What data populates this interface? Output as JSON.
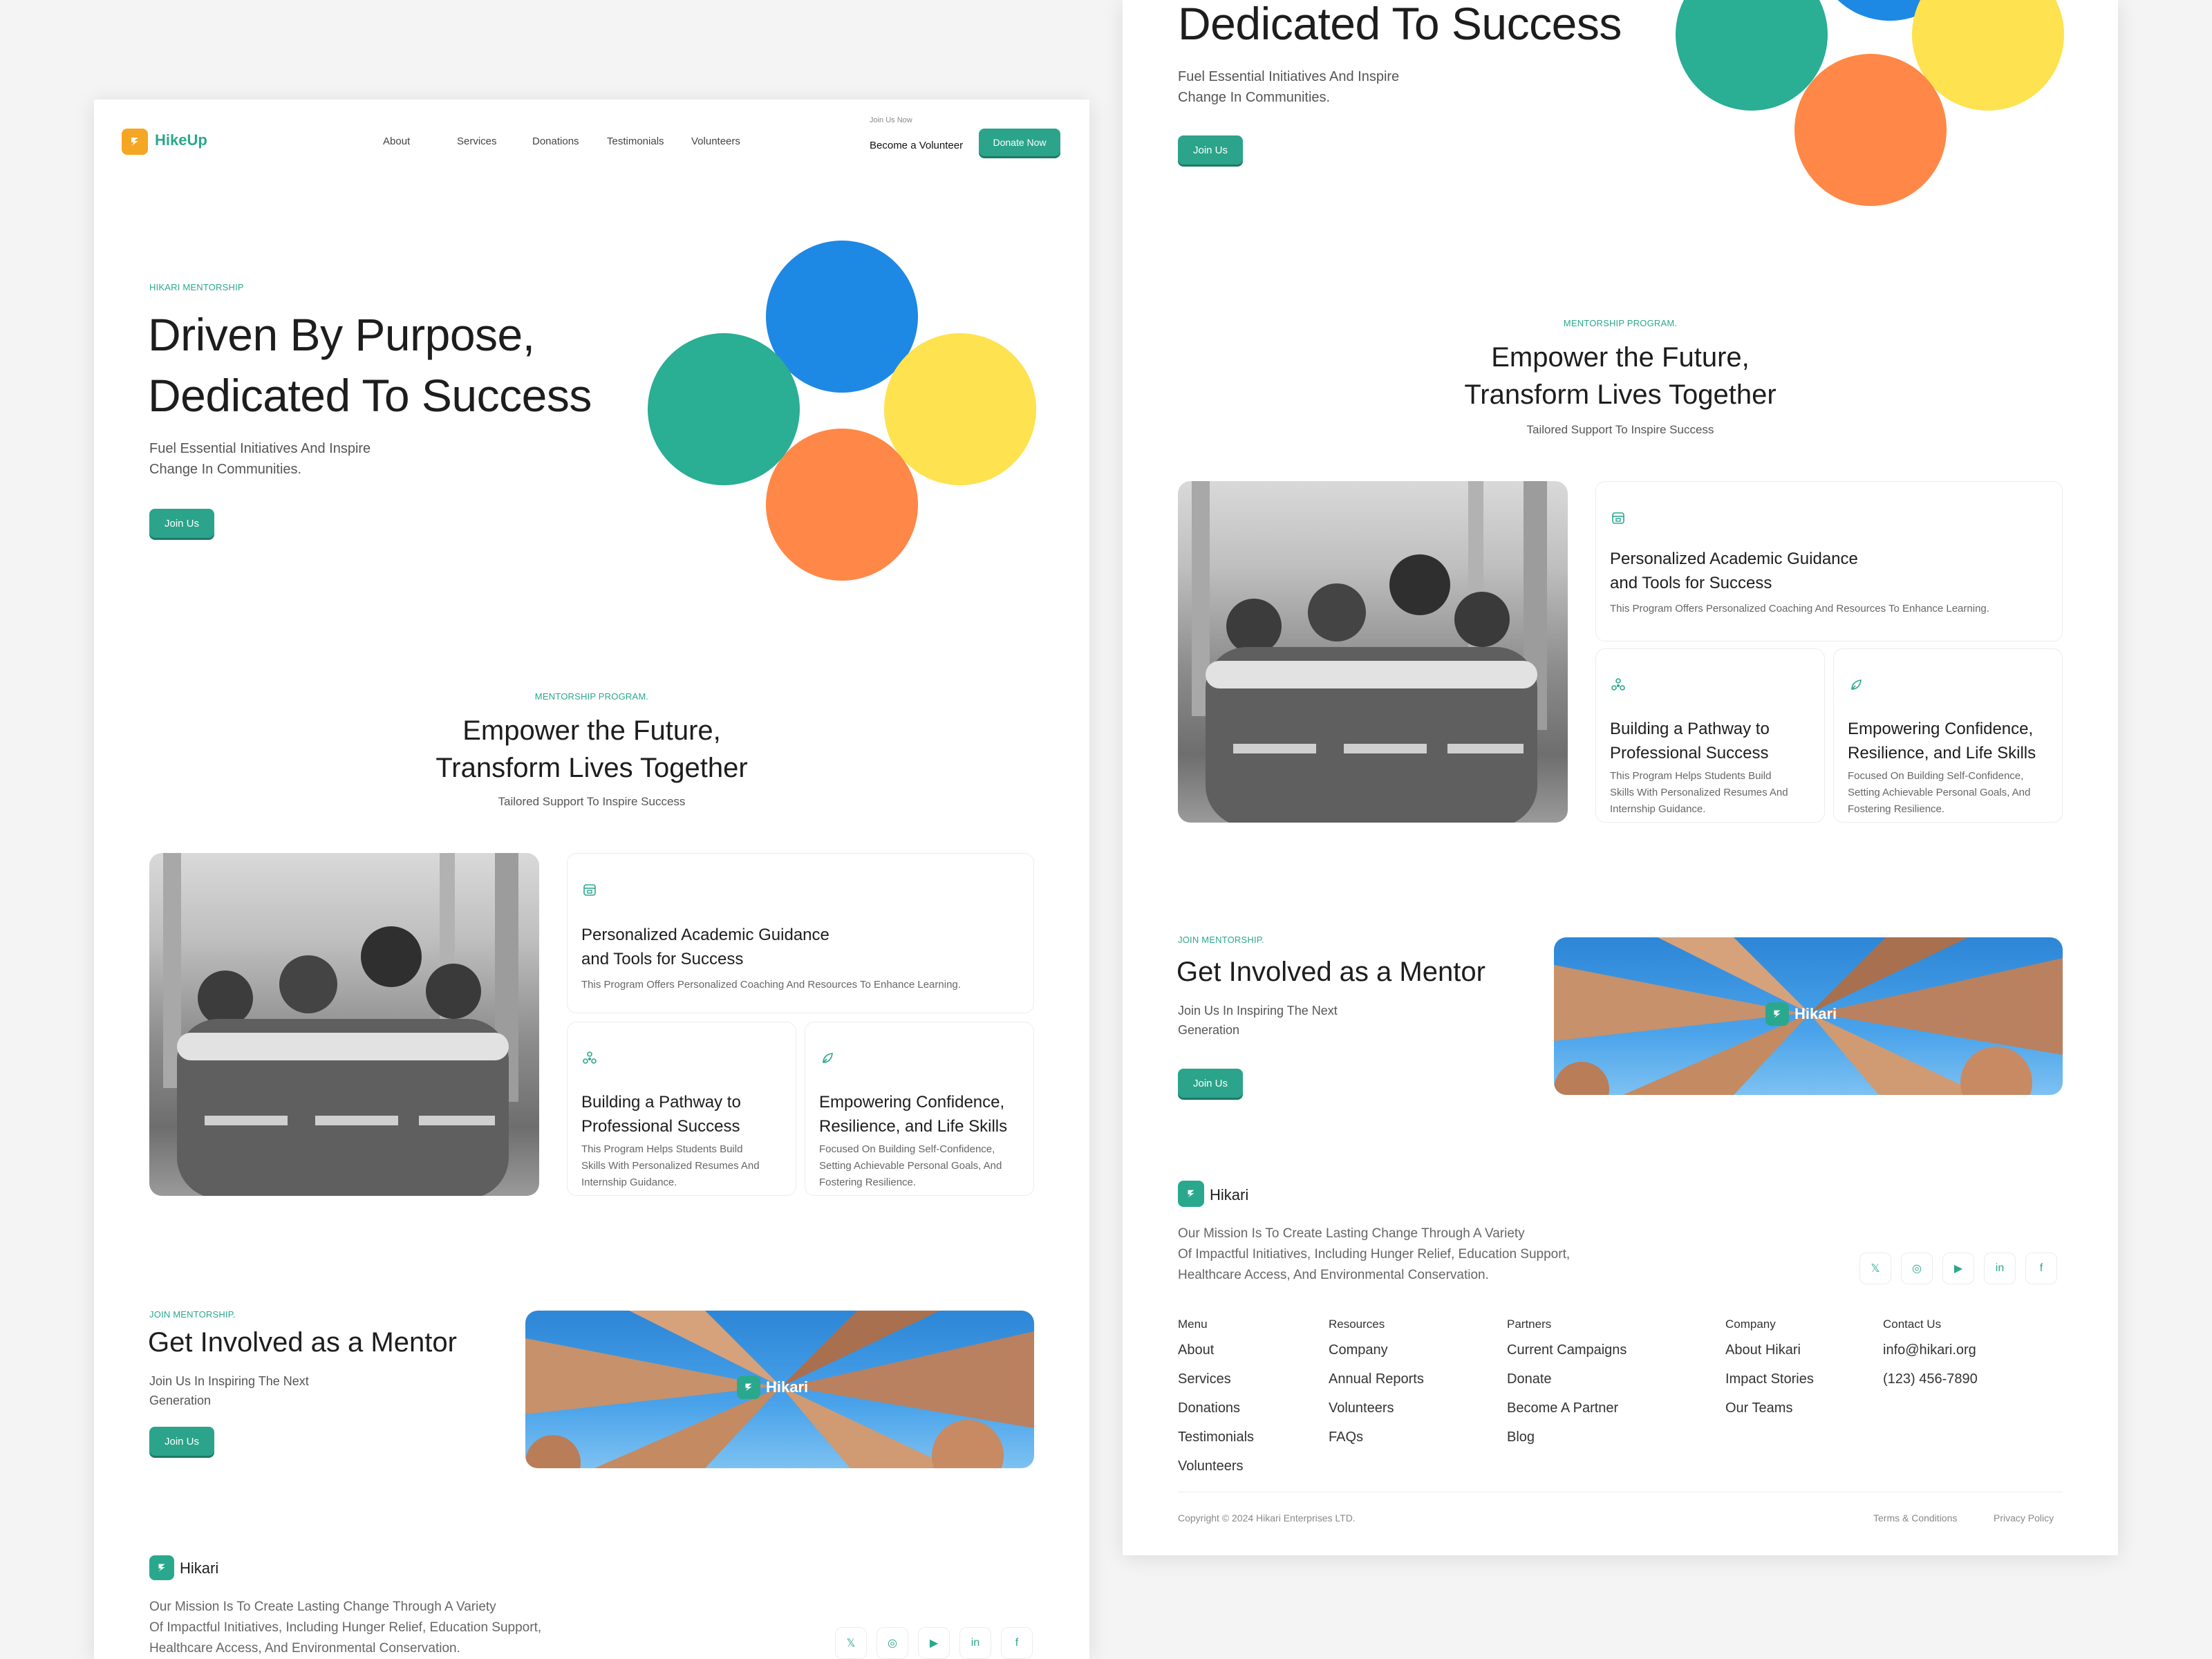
{
  "brand": {
    "name": "HikeUp",
    "footer_name": "Hikari",
    "photo_badge": "Hikari"
  },
  "nav": {
    "items": [
      "About",
      "Services",
      "Donations",
      "Testimonials",
      "Volunteers"
    ],
    "join_small": "Join Us Now",
    "volunteer": "Become a Volunteer",
    "donate": "Donate Now"
  },
  "hero": {
    "eyebrow": "HIKARI MENTORSHIP",
    "title_line1": "Driven By Purpose,",
    "title_line2": "Dedicated To Success",
    "sub_line1": "Fuel Essential Initiatives And Inspire",
    "sub_line2": "Change In Communities.",
    "cta": "Join Us"
  },
  "mentorship": {
    "eyebrow": "MENTORSHIP PROGRAM.",
    "title_line1": "Empower the Future,",
    "title_line2": "Transform Lives Together",
    "sub": "Tailored Support To Inspire Success",
    "features": [
      {
        "title_line1": "Personalized Academic Guidance",
        "title_line2": "and Tools for Success",
        "desc_line1": "This Program Offers Personalized Coaching And Resources To Enhance Learning.",
        "desc_line2": "",
        "desc_line3": ""
      },
      {
        "title_line1": "Building a Pathway to",
        "title_line2": "Professional Success",
        "desc_line1": "This Program Helps Students Build",
        "desc_line2": "Skills With Personalized Resumes And",
        "desc_line3": "Internship Guidance."
      },
      {
        "title_line1": "Empowering Confidence,",
        "title_line2": "Resilience, and Life Skills",
        "desc_line1": "Focused On Building Self-Confidence,",
        "desc_line2": "Setting Achievable Personal Goals, And",
        "desc_line3": "Fostering Resilience."
      }
    ]
  },
  "involve": {
    "eyebrow": "JOIN MENTORSHIP.",
    "title": "Get Involved as a Mentor",
    "sub_line1": "Join Us In Inspiring The Next",
    "sub_line2": "Generation",
    "cta": "Join Us"
  },
  "footer": {
    "mission_line1": "Our Mission Is To Create Lasting Change Through A Variety",
    "mission_line2": "Of Impactful Initiatives, Including Hunger Relief, Education Support,",
    "mission_line3": "Healthcare Access, And Environmental Conservation.",
    "social_icons": [
      "x-icon",
      "instagram-icon",
      "youtube-icon",
      "linkedin-icon",
      "facebook-icon"
    ],
    "social_glyphs": [
      "𝕏",
      "◎",
      "▶",
      "in",
      "f"
    ],
    "columns": [
      {
        "heading": "Menu",
        "links": [
          "About",
          "Services",
          "Donations",
          "Testimonials",
          "Volunteers"
        ]
      },
      {
        "heading": "Resources",
        "links": [
          "Company",
          "Annual Reports",
          "Volunteers",
          "FAQs"
        ]
      },
      {
        "heading": "Partners",
        "links": [
          "Current Campaigns",
          "Donate",
          "Become A Partner",
          "Blog"
        ]
      },
      {
        "heading": "Company",
        "links": [
          "About Hikari",
          "Impact Stories",
          "Our Teams"
        ]
      },
      {
        "heading": "Contact Us",
        "links": [
          "info@hikari.org",
          "(123) 456-7890"
        ]
      }
    ],
    "copyright": "Copyright © 2024 Hikari Enterprises LTD.",
    "terms": "Terms & Conditions",
    "privacy": "Privacy Policy"
  },
  "colors": {
    "accent": "#2ba48b",
    "logo_orange": "#f5a623",
    "circle_blue": "#1e88e5",
    "circle_green": "#2aae94",
    "circle_yellow": "#fee24f",
    "circle_orange": "#ff8747"
  }
}
